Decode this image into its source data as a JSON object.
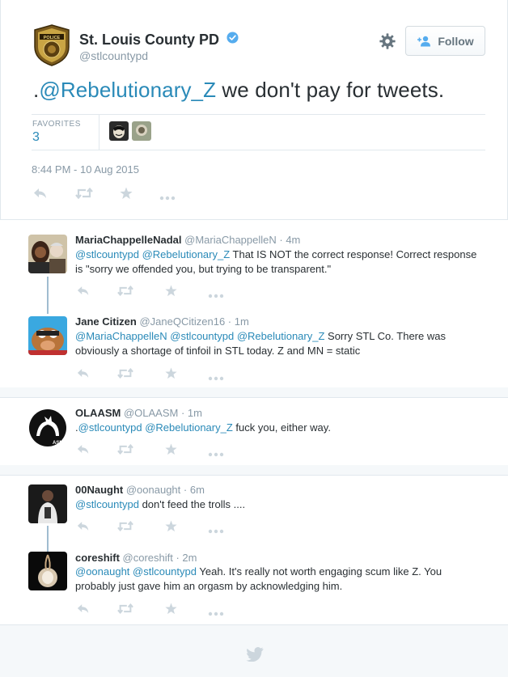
{
  "main_tweet": {
    "author_name": "St. Louis County PD",
    "author_handle": "@stlcountypd",
    "verified": true,
    "follow_label": "Follow",
    "text_prefix": ".",
    "mention": "@Rebelutionary_Z",
    "text_rest": " we don't pay for tweets.",
    "favorites_label": "FAVORITES",
    "favorites_count": "3",
    "timestamp": "8:44 PM - 10 Aug 2015"
  },
  "replies": [
    {
      "name": "MariaChappelleNadal",
      "handle": "@MariaChappelleN",
      "sep": " · ",
      "time": "4m",
      "mentions": "@stlcountypd @Rebelutionary_Z",
      "text": "  That IS NOT the correct response! Correct response is \"sorry we offended you, but trying to be transparent.\""
    },
    {
      "name": "Jane Citizen",
      "handle": "@JaneQCitizen16",
      "sep": " · ",
      "time": "1m",
      "mentions": "@MariaChappelleN @stlcountypd @Rebelutionary_Z",
      "text": "   Sorry STL Co. There was obviously a shortage of tinfoil in STL today. Z and MN = static"
    },
    {
      "name": "OLAASM",
      "handle": "@OLAASM",
      "sep": " · ",
      "time": "1m",
      "prefix": ".",
      "mentions": "@stlcountypd @Rebelutionary_Z",
      "text": " fuck you, either way."
    },
    {
      "name": "00Naught",
      "handle": "@oonaught",
      "sep": " · ",
      "time": "6m",
      "mentions": "@stlcountypd",
      "text": " don't feed the trolls ...."
    },
    {
      "name": "coreshift",
      "handle": "@coreshift",
      "sep": " · ",
      "time": "2m",
      "mentions": "@oonaught @stlcountypd",
      "text": " Yeah. It's really not worth engaging scum like Z. You probably just gave him an orgasm by acknowledging him."
    }
  ],
  "colors": {
    "link": "#2a8ab8",
    "muted": "#8899a6",
    "text": "#292f33",
    "verified": "#55acee",
    "action_icon": "#ccd6dd"
  },
  "icons": [
    "reply-icon",
    "retweet-icon",
    "favorite-icon",
    "more-icon",
    "gear-icon",
    "follow-person-icon",
    "verified-badge-icon",
    "twitter-bird-icon"
  ]
}
